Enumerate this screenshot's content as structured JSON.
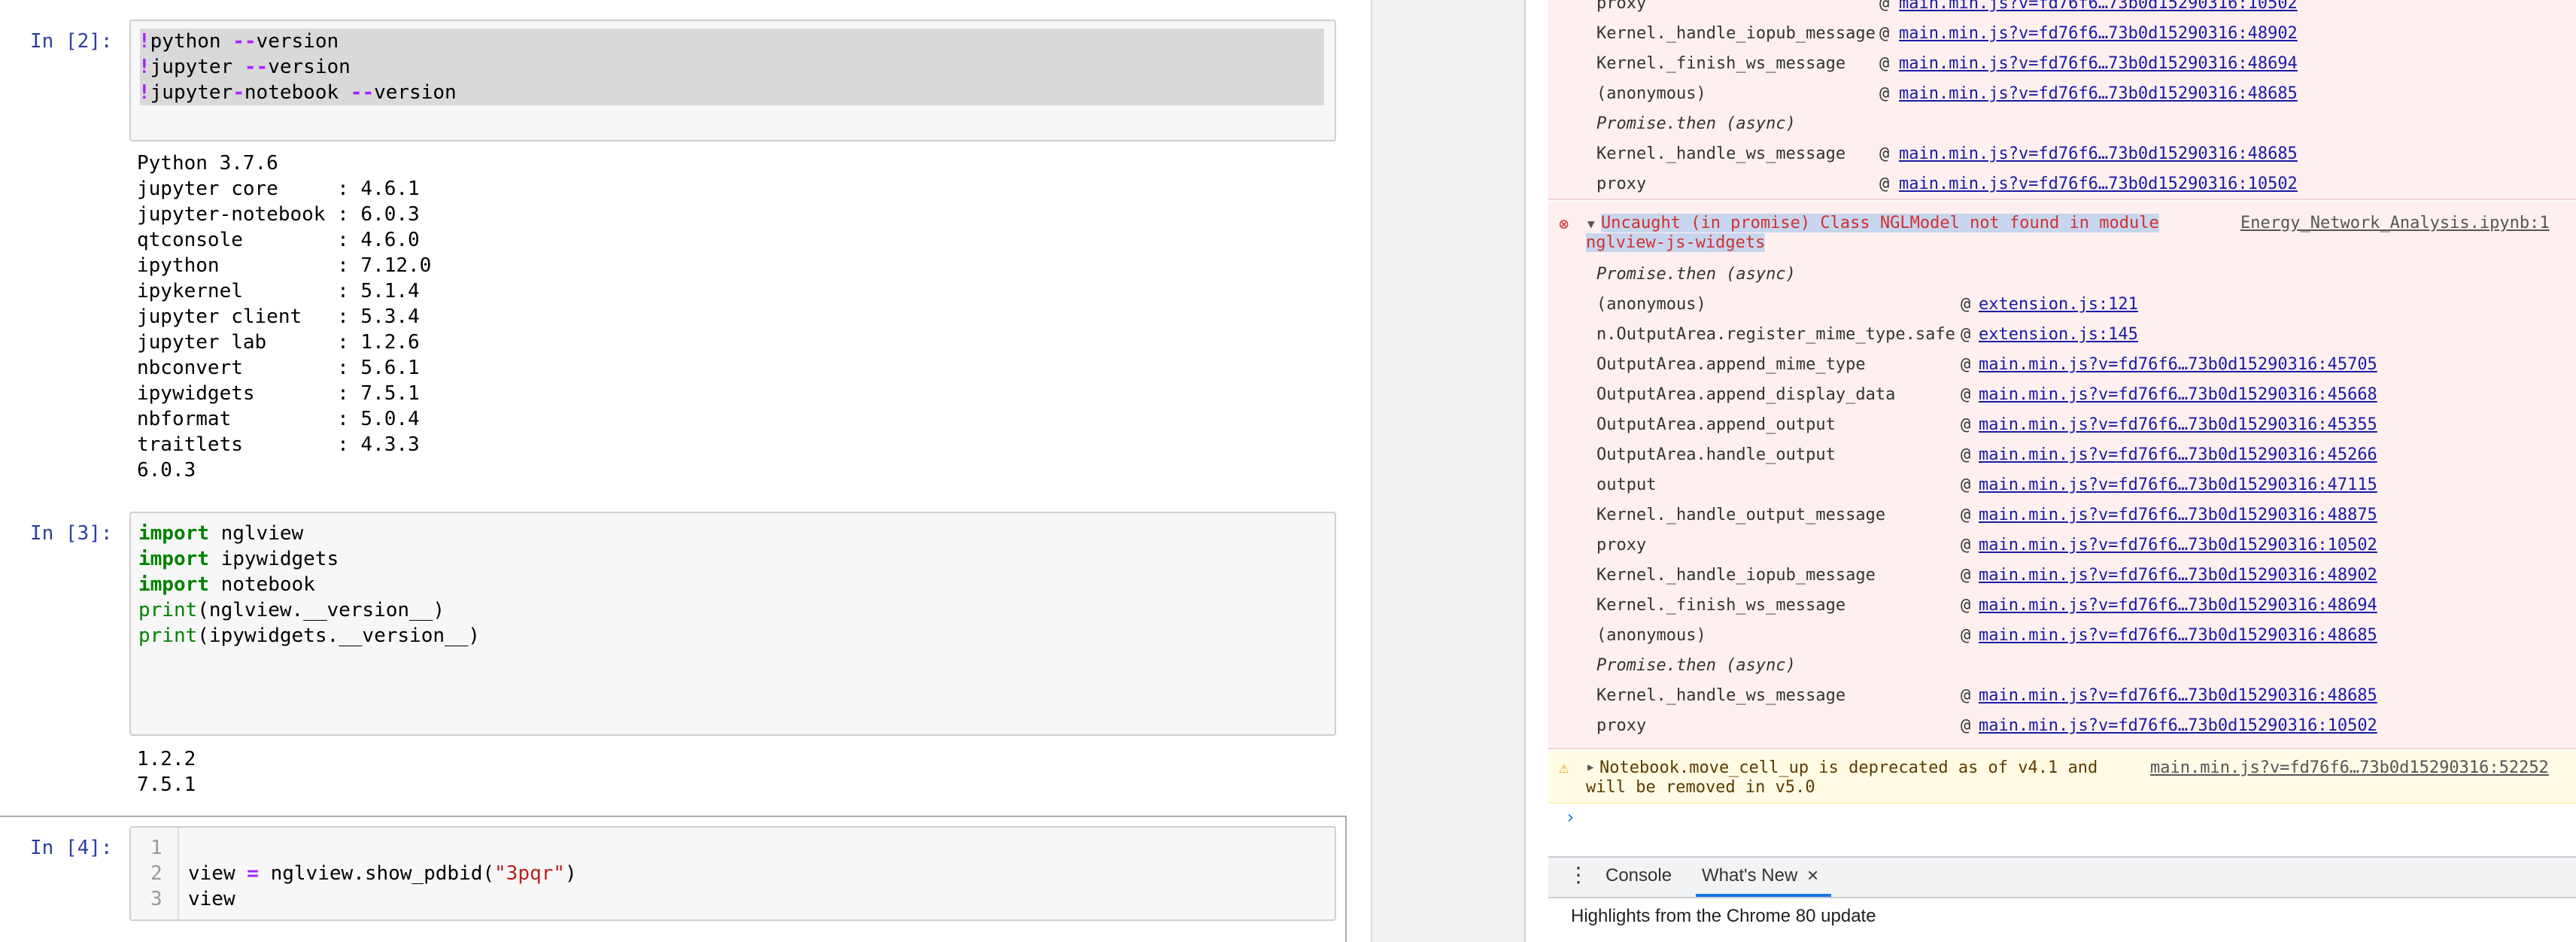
{
  "notebook": {
    "cells": [
      {
        "prompt": "In [2]:",
        "input_lines": [
          "!python --version",
          "!jupyter --version",
          "!jupyter-notebook --version"
        ],
        "output_lines": [
          "Python 3.7.6",
          "jupyter core     : 4.6.1",
          "jupyter-notebook : 6.0.3",
          "qtconsole        : 4.6.0",
          "ipython          : 7.12.0",
          "ipykernel        : 5.1.4",
          "jupyter client   : 5.3.4",
          "jupyter lab      : 1.2.6",
          "nbconvert        : 5.6.1",
          "ipywidgets       : 7.5.1",
          "nbformat         : 5.0.4",
          "traitlets        : 4.3.3",
          "6.0.3"
        ]
      },
      {
        "prompt": "In [3]:",
        "input_lines": [
          "import nglview",
          "import ipywidgets",
          "import notebook",
          "print(nglview.__version__)",
          "print(ipywidgets.__version__)"
        ],
        "output_lines": [
          "1.2.2",
          "7.5.1"
        ]
      },
      {
        "prompt": "In [4]:",
        "line_numbers": [
          "1",
          "2",
          "3"
        ],
        "input_lines": [
          "",
          "view = nglview.show_pdbid(\"3pqr\")",
          "view"
        ]
      }
    ]
  },
  "devtools": {
    "top_stack": [
      {
        "fn": "proxy",
        "src": "main.min.js?v=fd76f6…73b0d15290316:10502"
      },
      {
        "fn": "Kernel._handle_iopub_message",
        "src": "main.min.js?v=fd76f6…73b0d15290316:48902"
      },
      {
        "fn": "Kernel._finish_ws_message",
        "src": "main.min.js?v=fd76f6…73b0d15290316:48694"
      },
      {
        "fn": "(anonymous)",
        "src": "main.min.js?v=fd76f6…73b0d15290316:48685"
      },
      {
        "async": "Promise.then (async)"
      },
      {
        "fn": "Kernel._handle_ws_message",
        "src": "main.min.js?v=fd76f6…73b0d15290316:48685"
      },
      {
        "fn": "proxy",
        "src": "main.min.js?v=fd76f6…73b0d15290316:10502"
      }
    ],
    "error": {
      "message_line1": "Uncaught (in promise) Class NGLModel not found in module",
      "message_line2": "nglview-js-widgets",
      "source": "Energy_Network_Analysis.ipynb:1"
    },
    "error_stack": [
      {
        "async": "Promise.then (async)"
      },
      {
        "fn": "(anonymous)",
        "src": "extension.js:121"
      },
      {
        "fn": "n.OutputArea.register_mime_type.safe",
        "src": "extension.js:145"
      },
      {
        "fn": "OutputArea.append_mime_type",
        "src": "main.min.js?v=fd76f6…73b0d15290316:45705"
      },
      {
        "fn": "OutputArea.append_display_data",
        "src": "main.min.js?v=fd76f6…73b0d15290316:45668"
      },
      {
        "fn": "OutputArea.append_output",
        "src": "main.min.js?v=fd76f6…73b0d15290316:45355"
      },
      {
        "fn": "OutputArea.handle_output",
        "src": "main.min.js?v=fd76f6…73b0d15290316:45266"
      },
      {
        "fn": "output",
        "src": "main.min.js?v=fd76f6…73b0d15290316:47115"
      },
      {
        "fn": "Kernel._handle_output_message",
        "src": "main.min.js?v=fd76f6…73b0d15290316:48875"
      },
      {
        "fn": "proxy",
        "src": "main.min.js?v=fd76f6…73b0d15290316:10502"
      },
      {
        "fn": "Kernel._handle_iopub_message",
        "src": "main.min.js?v=fd76f6…73b0d15290316:48902"
      },
      {
        "fn": "Kernel._finish_ws_message",
        "src": "main.min.js?v=fd76f6…73b0d15290316:48694"
      },
      {
        "fn": "(anonymous)",
        "src": "main.min.js?v=fd76f6…73b0d15290316:48685"
      },
      {
        "async": "Promise.then (async)"
      },
      {
        "fn": "Kernel._handle_ws_message",
        "src": "main.min.js?v=fd76f6…73b0d15290316:48685"
      },
      {
        "fn": "proxy",
        "src": "main.min.js?v=fd76f6…73b0d15290316:10502"
      }
    ],
    "warning": {
      "line1": "Notebook.move_cell_up is deprecated as of v4.1 and",
      "line2": "will be removed in v5.0",
      "source": "main.min.js?v=fd76f6…73b0d15290316:52252"
    },
    "prompt_symbol": "›",
    "drawer": {
      "menu_icon": "⋮",
      "tabs": [
        {
          "label": "Console"
        },
        {
          "label": "What's New"
        }
      ],
      "close_icon": "×",
      "highlights": "Highlights from the Chrome 80 update"
    }
  },
  "colors": {
    "prompt_blue": "#303f9f",
    "keyword_green": "#008000",
    "operator_purple": "#aa22ff",
    "string_red": "#ba2121",
    "error_red": "#d32f2f",
    "error_bg": "#fff0f0",
    "warning_bg": "#fffbe5",
    "link_blue": "#1a1aa6",
    "tab_underline": "#1a73e8"
  }
}
